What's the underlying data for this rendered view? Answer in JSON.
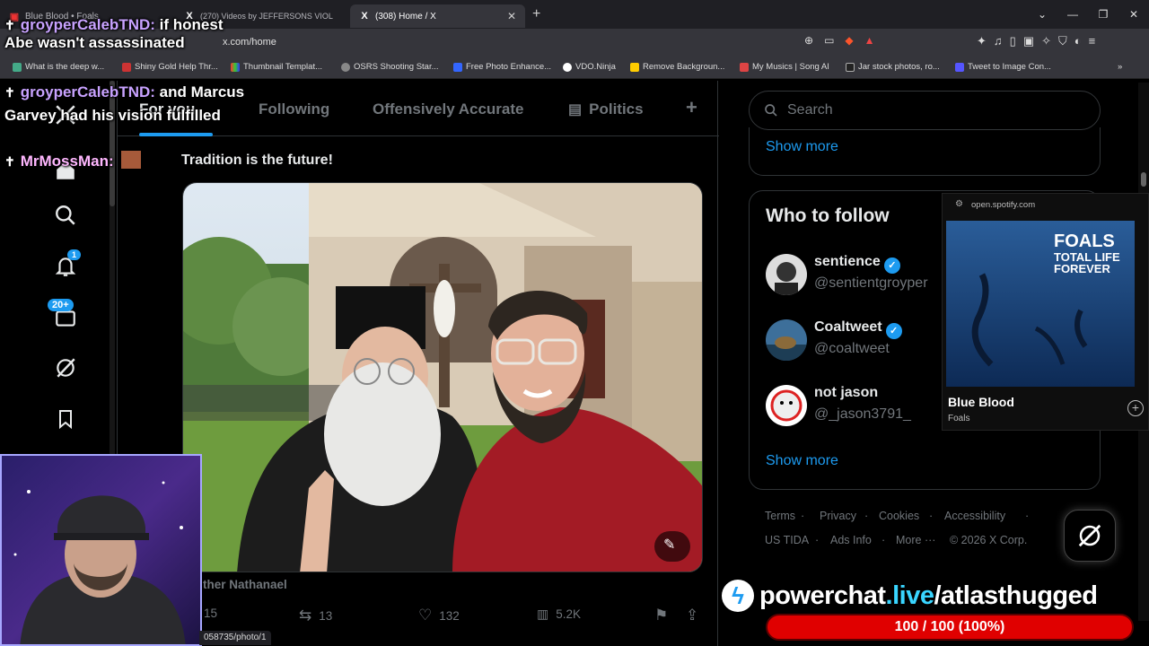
{
  "browser": {
    "tabs": [
      {
        "title": "Blue Blood • Foals",
        "active": false
      },
      {
        "title": "(270) Videos by JEFFERSONS VIOL",
        "active": false
      },
      {
        "title": "(308) Home / X",
        "active": true
      }
    ],
    "url": "x.com/home",
    "bookmarks": [
      "What is the deep w...",
      "Shiny Gold Help Thr...",
      "Thumbnail Templat...",
      "OSRS Shooting Star...",
      "Free Photo Enhance...",
      "VDO.Ninja",
      "Remove Backgroun...",
      "My Musics | Song AI",
      "Jar stock photos, ro...",
      "Tweet to Image Con..."
    ],
    "status_url": "058735/photo/1"
  },
  "nav": {
    "notifications_badge": "1",
    "messages_badge": "20+"
  },
  "feed": {
    "tabs": [
      "For you",
      "Following",
      "Offensively Accurate",
      "Politics"
    ],
    "tweet_text": "Tradition is the future!",
    "quote_author": "ther Nathanael",
    "stats": {
      "replies": "15",
      "reposts": "13",
      "likes": "132",
      "views": "5.2K"
    }
  },
  "sidebar": {
    "search_placeholder": "Search",
    "show_more_top": "Show more",
    "who_to_follow_title": "Who to follow",
    "users": [
      {
        "name": "sentience",
        "handle": "@sentientgroyper",
        "verified": true
      },
      {
        "name": "Coaltweet",
        "handle": "@coaltweet",
        "verified": true
      },
      {
        "name": "not jason",
        "handle": "@_jason3791_",
        "verified": false
      }
    ],
    "show_more_bottom": "Show more",
    "footer": [
      "Terms",
      "Privacy",
      "Cookies",
      "Accessibility",
      "US TIDA",
      "Ads Info",
      "More ···",
      "© 2026 X Corp."
    ]
  },
  "spotify": {
    "domain": "open.spotify.com",
    "album_line1": "FOALS",
    "album_line2": "TOTAL LIFE FOREVER",
    "track": "Blue Blood",
    "artist": "Foals"
  },
  "chat": [
    {
      "user": "groyperCalebTND:",
      "message": "if honest Abe wasn't assassinated"
    },
    {
      "user": "groyperCalebTND:",
      "message": "and Marcus Garvey had his vision fulfilled"
    },
    {
      "user": "MrMossMan:",
      "message": ""
    }
  ],
  "powerchat": {
    "domain": "powerchat",
    "tld": ".live",
    "path": "/atlasthugged",
    "goal_label": "100 / 100 (100%)",
    "progress": 1.0
  },
  "colors": {
    "accent": "#1d9bf0",
    "background": "#000000",
    "muted": "#71767b",
    "powerchat_bar": "#e00000"
  }
}
